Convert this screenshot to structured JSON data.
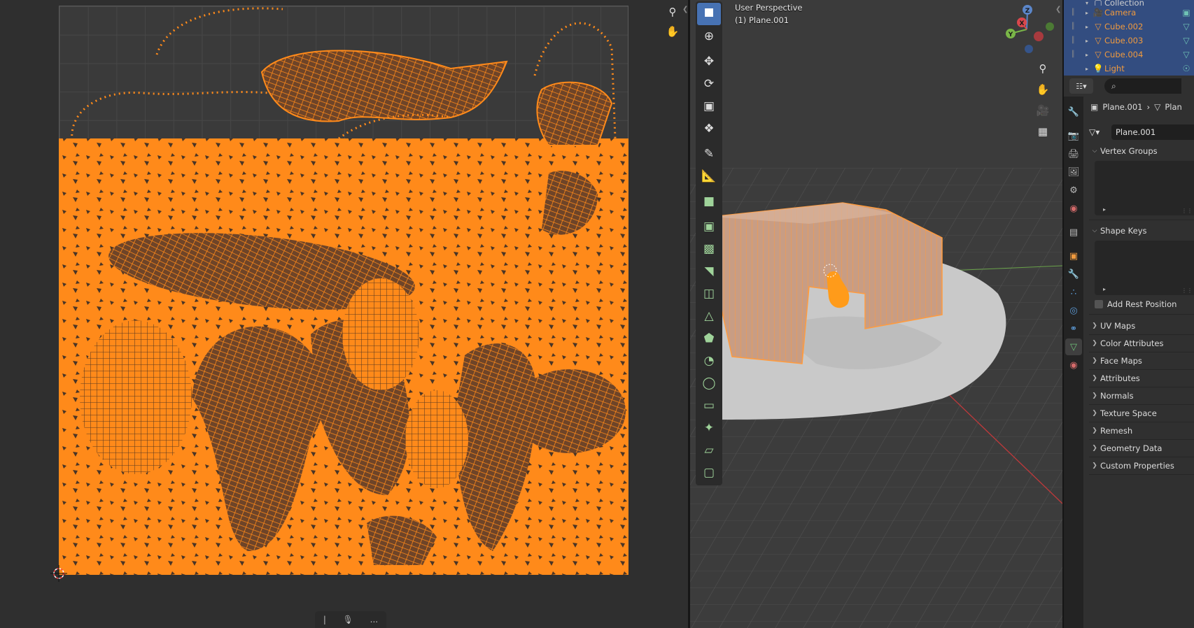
{
  "uv_editor": {
    "nav": {
      "zoom_icon": "zoom-icon",
      "pan_icon": "hand-pan-icon"
    },
    "bottom_bar": {
      "item1": "|",
      "item2": "🎙",
      "item3": "..."
    }
  },
  "viewport": {
    "view_name": "User Perspective",
    "object_label": "(1) Plane.001",
    "gizmo": {
      "z": "Z",
      "y": "Y",
      "x": "X"
    }
  },
  "outliner": {
    "items": [
      {
        "label": "Collection",
        "icon": "collection-icon"
      },
      {
        "label": "Camera",
        "icon": "camera-icon"
      },
      {
        "label": "Cube.002",
        "icon": "mesh-icon"
      },
      {
        "label": "Cube.003",
        "icon": "mesh-icon"
      },
      {
        "label": "Cube.004",
        "icon": "mesh-icon"
      },
      {
        "label": "Light",
        "icon": "light-icon"
      }
    ]
  },
  "properties": {
    "search_icon": "⌕",
    "breadcrumb": {
      "object": "Plane.001",
      "separator": "›",
      "data": "Plan"
    },
    "datablock_name": "Plane.001",
    "panels": {
      "vertex_groups": "Vertex Groups",
      "shape_keys": "Shape Keys",
      "add_rest_position": "Add Rest Position",
      "uv_maps": "UV Maps",
      "color_attributes": "Color Attributes",
      "face_maps": "Face Maps",
      "attributes": "Attributes",
      "normals": "Normals",
      "texture_space": "Texture Space",
      "remesh": "Remesh",
      "geometry_data": "Geometry Data",
      "custom_properties": "Custom Properties"
    }
  },
  "colors": {
    "accent": "#4772b3",
    "uv_orange": "#ff8a1a",
    "selection_blue": "#334d80"
  }
}
